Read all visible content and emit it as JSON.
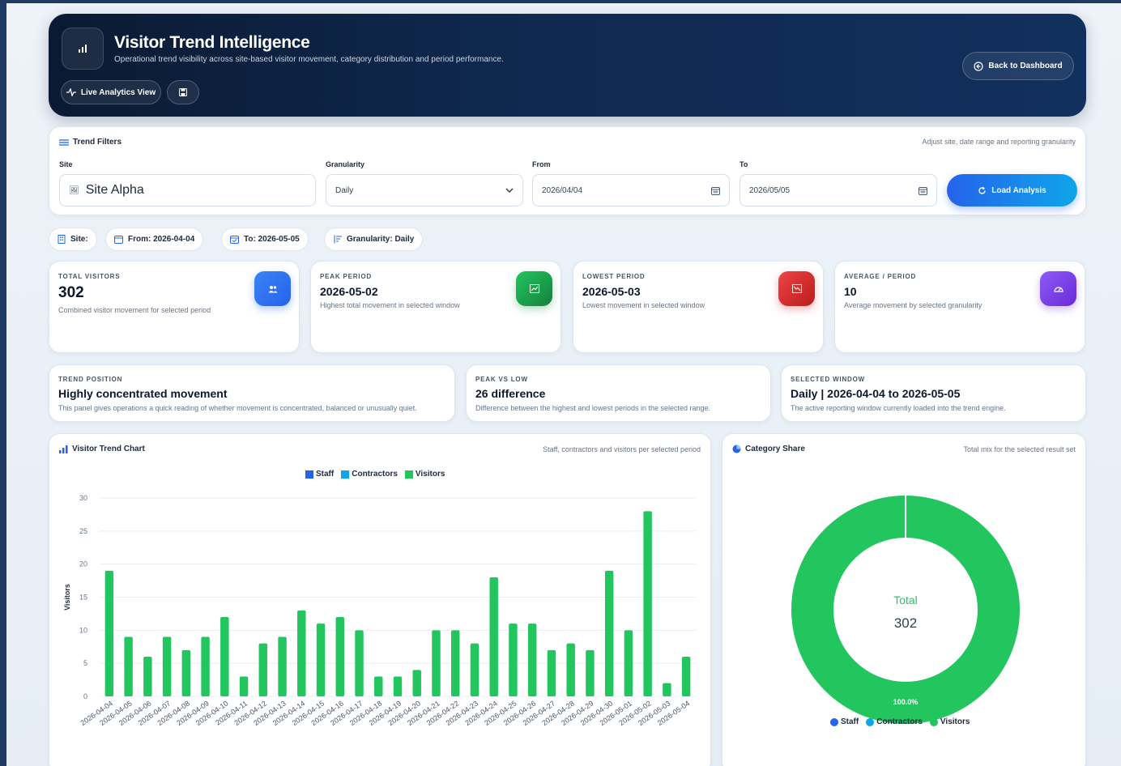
{
  "header": {
    "title": "Visitor Trend Intelligence",
    "subtitle": "Operational trend visibility across site-based visitor movement, category distribution and period performance.",
    "live_label": "Live Analytics View",
    "back_label": "Back to Dashboard"
  },
  "filters": {
    "title": "Trend Filters",
    "hint": "Adjust site, date range and reporting granularity",
    "site_label": "Site",
    "site_value": "Site Alpha",
    "granularity_label": "Granularity",
    "granularity_value": "Daily",
    "from_label": "From",
    "from_value": "2026/04/04",
    "to_label": "To",
    "to_value": "2026/05/05",
    "load_label": "Load Analysis"
  },
  "chips": {
    "site": "Site:",
    "from": "From: 2026-04-04",
    "to": "To: 2026-05-05",
    "granularity": "Granularity: Daily"
  },
  "kpis": [
    {
      "label": "TOTAL VISITORS",
      "value": "302",
      "desc": "Combined visitor movement for selected period",
      "color": "#2563eb"
    },
    {
      "label": "PEAK PERIOD",
      "value": "2026-05-02",
      "desc": "Highest total movement in selected window",
      "color": "#16a34a"
    },
    {
      "label": "LOWEST PERIOD",
      "value": "2026-05-03",
      "desc": "Lowest movement in selected window",
      "color": "#dc2626"
    },
    {
      "label": "AVERAGE / PERIOD",
      "value": "10",
      "desc": "Average movement by selected granularity",
      "color": "#7c3aed"
    }
  ],
  "insights": [
    {
      "label": "TREND POSITION",
      "value": "Highly concentrated movement",
      "desc": "This panel gives operations a quick reading of whether movement is concentrated, balanced or unusually quiet."
    },
    {
      "label": "PEAK VS LOW",
      "value": "26 difference",
      "desc": "Difference between the highest and lowest periods in the selected range."
    },
    {
      "label": "SELECTED WINDOW",
      "value": "Daily | 2026-04-04 to 2026-05-05",
      "desc": "The active reporting window currently loaded into the trend engine."
    }
  ],
  "trend_panel": {
    "title": "Visitor Trend Chart",
    "hint": "Staff, contractors and visitors per selected period"
  },
  "share_panel": {
    "title": "Category Share",
    "hint": "Total mix for the selected result set",
    "center_label": "Total",
    "center_value": "302",
    "slice_label": "100.0%"
  },
  "colors": {
    "staff": "#2563eb",
    "contractors": "#0ea5e9",
    "visitors": "#22c55e"
  },
  "chart_data": [
    {
      "type": "bar",
      "ylabel": "Visitors",
      "ylim": [
        0,
        30
      ],
      "yticks": [
        0,
        5,
        10,
        15,
        20,
        25,
        30
      ],
      "grid": true,
      "legend": "top-center",
      "categories": [
        "2026-04-04",
        "2026-04-05",
        "2026-04-06",
        "2026-04-07",
        "2026-04-08",
        "2026-04-09",
        "2026-04-10",
        "2026-04-11",
        "2026-04-12",
        "2026-04-13",
        "2026-04-14",
        "2026-04-15",
        "2026-04-16",
        "2026-04-17",
        "2026-04-18",
        "2026-04-19",
        "2026-04-20",
        "2026-04-21",
        "2026-04-22",
        "2026-04-23",
        "2026-04-24",
        "2026-04-25",
        "2026-04-26",
        "2026-04-27",
        "2026-04-28",
        "2026-04-29",
        "2026-04-30",
        "2026-05-01",
        "2026-05-02",
        "2026-05-03",
        "2026-05-04"
      ],
      "series": [
        {
          "name": "Staff",
          "values": [
            0,
            0,
            0,
            0,
            0,
            0,
            0,
            0,
            0,
            0,
            0,
            0,
            0,
            0,
            0,
            0,
            0,
            0,
            0,
            0,
            0,
            0,
            0,
            0,
            0,
            0,
            0,
            0,
            0,
            0,
            0
          ]
        },
        {
          "name": "Contractors",
          "values": [
            0,
            0,
            0,
            0,
            0,
            0,
            0,
            0,
            0,
            0,
            0,
            0,
            0,
            0,
            0,
            0,
            0,
            0,
            0,
            0,
            0,
            0,
            0,
            0,
            0,
            0,
            0,
            0,
            0,
            0,
            0
          ]
        },
        {
          "name": "Visitors",
          "values": [
            19,
            9,
            6,
            9,
            7,
            9,
            12,
            3,
            8,
            9,
            13,
            11,
            12,
            10,
            3,
            3,
            4,
            10,
            10,
            8,
            18,
            11,
            11,
            7,
            8,
            7,
            19,
            10,
            28,
            2,
            6
          ]
        }
      ]
    },
    {
      "type": "pie",
      "categories": [
        "Staff",
        "Contractors",
        "Visitors"
      ],
      "values": [
        0,
        0,
        302
      ],
      "legend": "bottom-center"
    }
  ]
}
